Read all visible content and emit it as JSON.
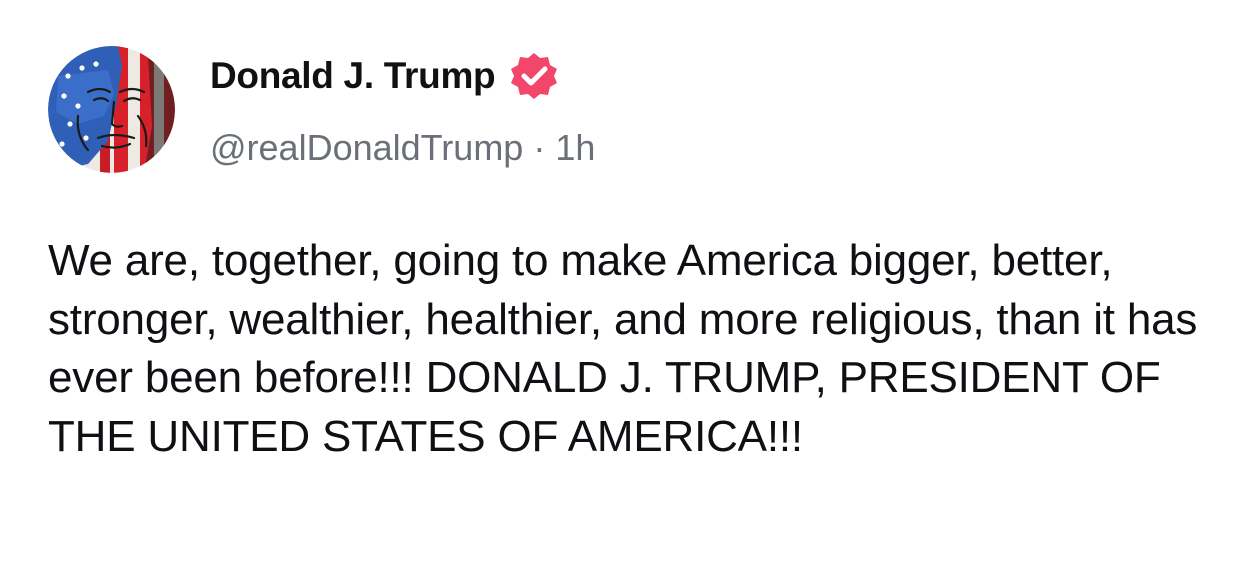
{
  "post": {
    "author": {
      "display_name": "Donald J. Trump",
      "handle": "@realDonaldTrump",
      "verified_icon": "verified-badge-icon",
      "verified_color": "#f2466b",
      "avatar_icon": "flag-face-avatar"
    },
    "separator": "·",
    "timestamp": "1h",
    "text": "We are, together, going to make America bigger, better, stronger, wealthier, healthier, and more religious, than it has ever been before!!! DONALD J. TRUMP, PRESIDENT OF THE UNITED STATES OF AMERICA!!!"
  }
}
